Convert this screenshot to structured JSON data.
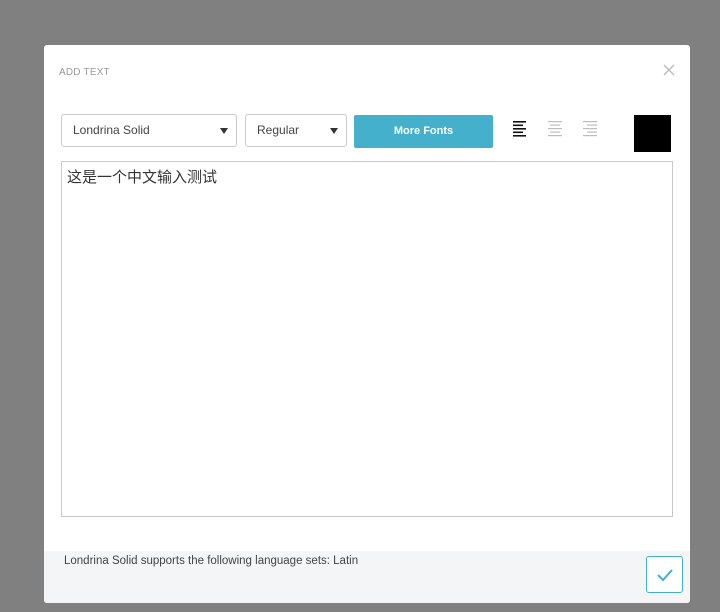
{
  "dialog": {
    "title": "ADD TEXT",
    "close_icon": "close-icon"
  },
  "toolbar": {
    "font_select": {
      "value": "Londrina Solid"
    },
    "weight_select": {
      "value": "Regular"
    },
    "more_fonts_label": "More Fonts",
    "alignment": {
      "options": [
        "align-left-icon",
        "align-center-icon",
        "align-right-icon"
      ],
      "selected": "align-left"
    },
    "text_color": "#000000"
  },
  "editor": {
    "text": "这是一个中文输入测试"
  },
  "footer": {
    "language_info": "Londrina Solid supports the following language sets: Latin",
    "confirm_icon": "checkmark-icon"
  },
  "colors": {
    "accent": "#44b0cc",
    "backdrop": "#808080",
    "footer_bg": "#f4f5f7"
  }
}
